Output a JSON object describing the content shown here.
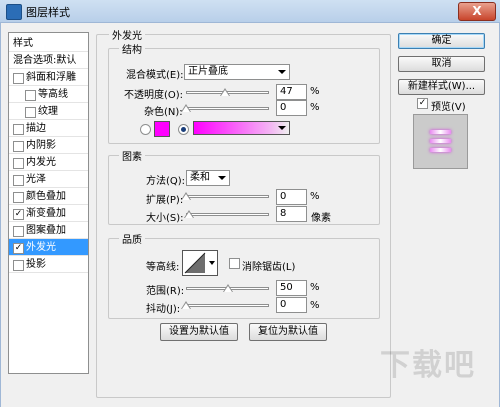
{
  "window": {
    "title": "图层样式",
    "close_label": "X"
  },
  "left_panel": {
    "items": [
      {
        "label": "样式",
        "checkbox": false,
        "checked": false,
        "selected": false
      },
      {
        "label": "混合选项:默认",
        "checkbox": false,
        "checked": false,
        "selected": false
      },
      {
        "label": "斜面和浮雕",
        "checkbox": true,
        "checked": false,
        "selected": false
      },
      {
        "label": "等高线",
        "checkbox": true,
        "checked": false,
        "selected": false
      },
      {
        "label": "纹理",
        "checkbox": true,
        "checked": false,
        "selected": false
      },
      {
        "label": "描边",
        "checkbox": true,
        "checked": false,
        "selected": false
      },
      {
        "label": "内阴影",
        "checkbox": true,
        "checked": false,
        "selected": false
      },
      {
        "label": "内发光",
        "checkbox": true,
        "checked": false,
        "selected": false
      },
      {
        "label": "光泽",
        "checkbox": true,
        "checked": false,
        "selected": false
      },
      {
        "label": "颜色叠加",
        "checkbox": true,
        "checked": false,
        "selected": false
      },
      {
        "label": "渐变叠加",
        "checkbox": true,
        "checked": true,
        "selected": false
      },
      {
        "label": "图案叠加",
        "checkbox": true,
        "checked": false,
        "selected": false
      },
      {
        "label": "外发光",
        "checkbox": true,
        "checked": true,
        "selected": true
      },
      {
        "label": "投影",
        "checkbox": true,
        "checked": false,
        "selected": false
      }
    ]
  },
  "outer_glow": {
    "section_title": "外发光",
    "structure": {
      "title": "结构",
      "blend_mode_label": "混合模式(E):",
      "blend_mode_value": "正片叠底",
      "opacity_label": "不透明度(O):",
      "opacity_value": "47",
      "opacity_unit": "%",
      "noise_label": "杂色(N):",
      "noise_value": "0",
      "noise_unit": "%",
      "color": "#ff00ff"
    },
    "elements": {
      "title": "图素",
      "method_label": "方法(Q):",
      "method_value": "柔和",
      "spread_label": "扩展(P):",
      "spread_value": "0",
      "spread_unit": "%",
      "size_label": "大小(S):",
      "size_value": "8",
      "size_unit": "像素"
    },
    "quality": {
      "title": "品质",
      "contour_label": "等高线:",
      "anti_alias_label": "消除锯齿(L)",
      "range_label": "范围(R):",
      "range_value": "50",
      "range_unit": "%",
      "jitter_label": "抖动(J):",
      "jitter_value": "0",
      "jitter_unit": "%"
    },
    "make_default_label": "设置为默认值",
    "reset_default_label": "复位为默认值"
  },
  "right_panel": {
    "ok_label": "确定",
    "cancel_label": "取消",
    "new_style_label": "新建样式(W)...",
    "preview_label": "预览(V)",
    "preview_checked": true
  },
  "watermark": "下载吧"
}
